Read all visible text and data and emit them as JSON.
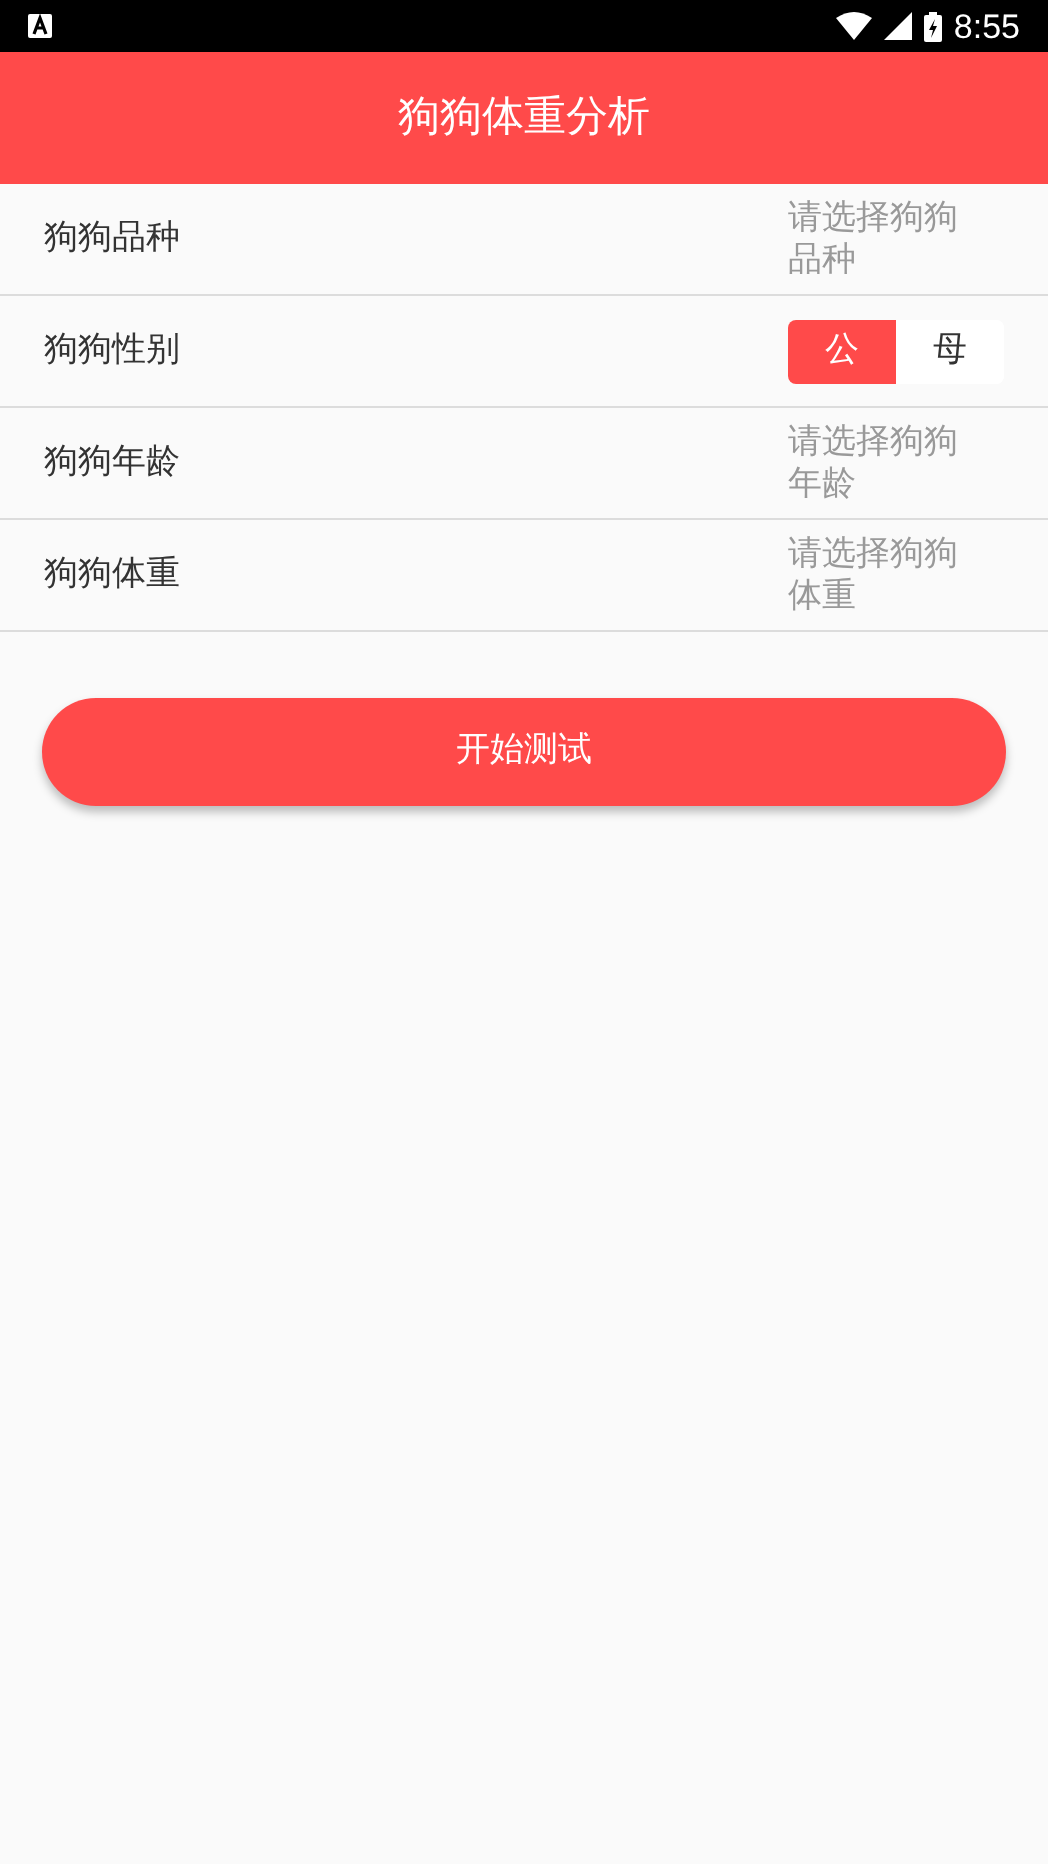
{
  "status_bar": {
    "time": "8:55"
  },
  "app_bar": {
    "title": "狗狗体重分析"
  },
  "rows": [
    {
      "kind": "picker",
      "label": "狗狗品种",
      "placeholder": "请选择狗狗品种"
    },
    {
      "kind": "segmented",
      "label": "狗狗性别",
      "options": [
        {
          "label": "公",
          "selected": true
        },
        {
          "label": "母",
          "selected": false
        }
      ]
    },
    {
      "kind": "picker",
      "label": "狗狗年龄",
      "placeholder": "请选择狗狗年龄"
    },
    {
      "kind": "picker",
      "label": "狗狗体重",
      "placeholder": "请选择狗狗体重"
    }
  ],
  "start_button": "开始测试"
}
